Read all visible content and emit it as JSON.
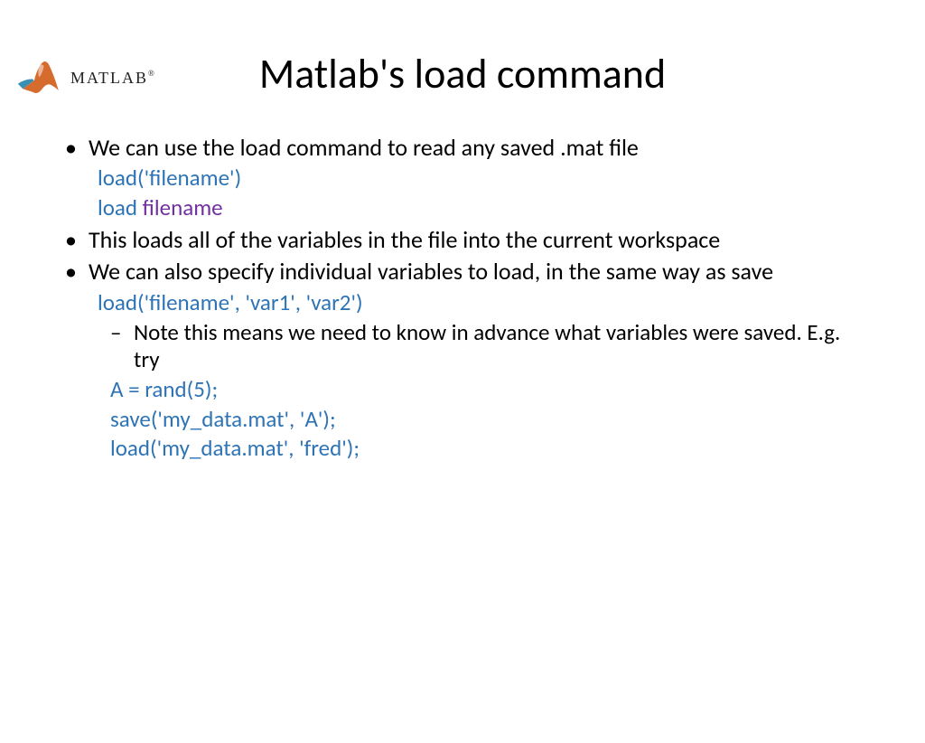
{
  "logo": {
    "text": "MATLAB",
    "trademark": "®"
  },
  "title": "Matlab's load command",
  "bullets": {
    "b1": "We can use the load command to read any saved .mat file",
    "b1_code1": "load('filename')",
    "b1_code2_a": "load",
    "b1_code2_b": " filename",
    "b2": "This loads all of the variables in the file into the current workspace",
    "b3": "We can also specify individual variables to load, in the same way as save",
    "b3_code1": "load('filename', 'var1', 'var2')",
    "b3_dash": "Note this means we need to know in advance what variables were saved. E.g. try",
    "b3_code2": "A = rand(5);",
    "b3_code3": "save('my_data.mat', 'A');",
    "b3_code4": "load('my_data.mat', 'fred');"
  }
}
